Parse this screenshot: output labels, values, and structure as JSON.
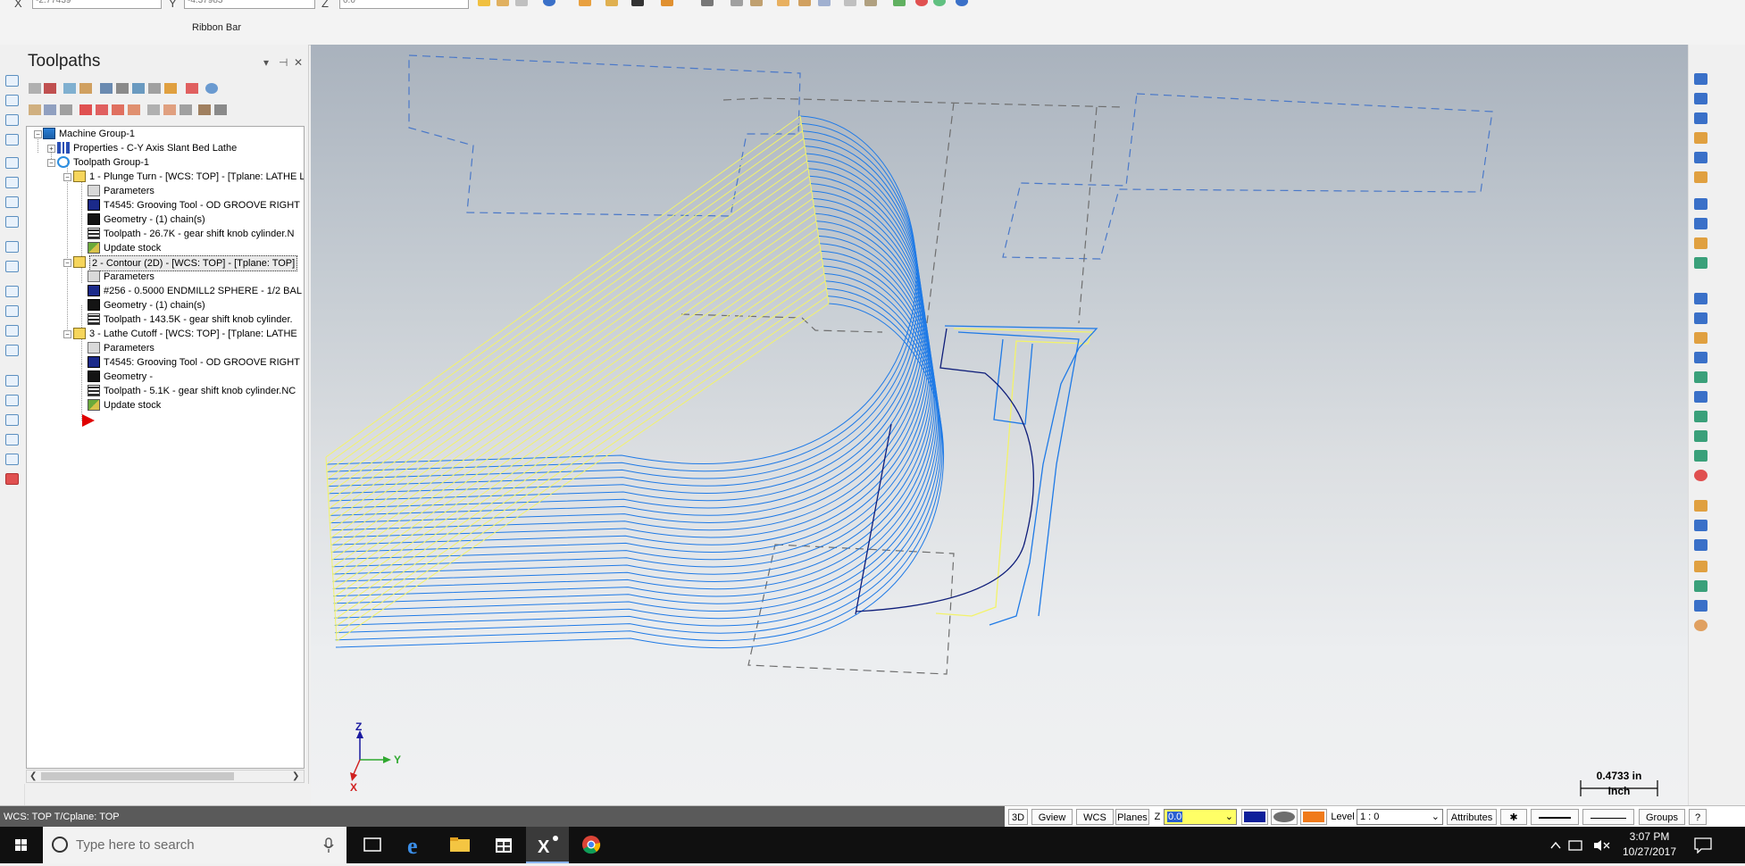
{
  "ribbon": {
    "x_label": "X",
    "x_value": "-2.77439",
    "y_label": "Y",
    "y_value": "-4.37983",
    "z_label": "Z",
    "z_value": "0.0",
    "ribbon_bar_label": "Ribbon Bar"
  },
  "panel": {
    "title": "Toolpaths",
    "pin_glyph": "▾",
    "autohide_glyph": "⊣",
    "close_glyph": "✕",
    "tree": [
      {
        "label": "Machine Group-1",
        "icon": "machine-group-icon"
      },
      {
        "label": "Properties - C-Y Axis Slant Bed Lathe",
        "icon": "properties-icon"
      },
      {
        "label": "Toolpath Group-1",
        "icon": "toolpath-group-icon"
      },
      {
        "label": "1 - Plunge Turn - [WCS: TOP] - [Tplane: LATHE L",
        "icon": "operation-folder-icon"
      },
      {
        "label": "Parameters",
        "icon": "parameters-icon"
      },
      {
        "label": "T4545: Grooving Tool - OD GROOVE RIGHT",
        "icon": "tool-icon"
      },
      {
        "label": "Geometry - (1) chain(s)",
        "icon": "geometry-icon"
      },
      {
        "label": "Toolpath - 26.7K - gear shift knob cylinder.N",
        "icon": "toolpath-icon"
      },
      {
        "label": "Update stock",
        "icon": "update-stock-icon"
      },
      {
        "label": "2 - Contour (2D) - [WCS: TOP] - [Tplane: TOP]",
        "icon": "operation-folder-icon"
      },
      {
        "label": "Parameters",
        "icon": "parameters-icon"
      },
      {
        "label": "#256 - 0.5000 ENDMILL2 SPHERE - 1/2 BAL",
        "icon": "tool-icon"
      },
      {
        "label": "Geometry - (1) chain(s)",
        "icon": "geometry-icon"
      },
      {
        "label": "Toolpath - 143.5K - gear shift knob cylinder.",
        "icon": "toolpath-icon"
      },
      {
        "label": "3 - Lathe Cutoff - [WCS: TOP] - [Tplane: LATHE",
        "icon": "operation-folder-icon"
      },
      {
        "label": "Parameters",
        "icon": "parameters-icon"
      },
      {
        "label": "T4545: Grooving Tool - OD GROOVE RIGHT",
        "icon": "tool-icon"
      },
      {
        "label": "Geometry -",
        "icon": "geometry-icon"
      },
      {
        "label": "Toolpath - 5.1K - gear shift knob cylinder.NC",
        "icon": "toolpath-icon"
      },
      {
        "label": "Update stock",
        "icon": "update-stock-icon"
      }
    ]
  },
  "viewport": {
    "axis_z": "Z",
    "axis_y": "Y",
    "axis_x": "X",
    "scale_value": "0.4733 in",
    "scale_unit": "Inch"
  },
  "status": {
    "wcs_text": "WCS: TOP  T/Cplane: TOP",
    "btn_3d": "3D",
    "btn_gview": "Gview",
    "btn_wcs": "WCS",
    "btn_planes": "Planes",
    "z_label": "Z",
    "z_value": "0.0",
    "level_label": "Level",
    "level_value": "1 : 0",
    "attributes": "Attributes",
    "groups": "Groups",
    "help": "?"
  },
  "taskbar": {
    "search_placeholder": "Type here to search",
    "time": "3:07 PM",
    "date": "10/27/2017"
  },
  "colors": {
    "toolpath_blue": "#1f7ae6",
    "toolpath_yellow": "#f3f36a",
    "geometry_navy": "#0f1e7a",
    "dashed_gray": "#6e6e6e",
    "dashed_blue": "#4a78c8",
    "status_gray": "#5a5a5a",
    "z_field_yellow": "#ffff66"
  }
}
